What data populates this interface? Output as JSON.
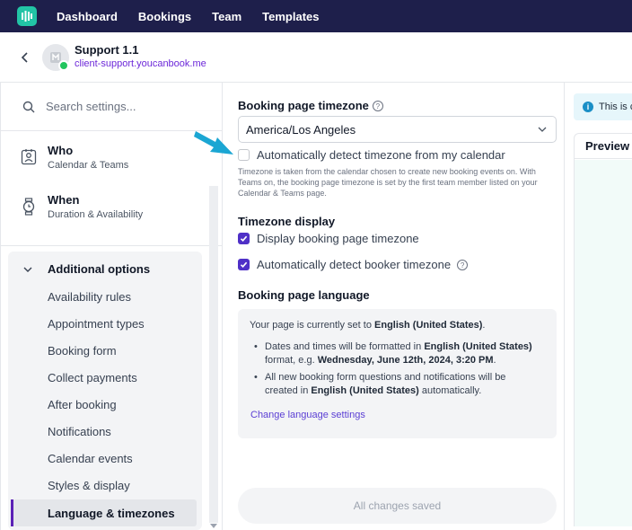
{
  "topnav": {
    "links": [
      "Dashboard",
      "Bookings",
      "Team",
      "Templates"
    ]
  },
  "header": {
    "site_name": "Support 1.1",
    "site_url": "client-support.youcanbook.me"
  },
  "sidebar": {
    "search_placeholder": "Search settings...",
    "main_items": [
      {
        "title": "Who",
        "subtitle": "Calendar & Teams",
        "icon": "contact-card-icon"
      },
      {
        "title": "When",
        "subtitle": "Duration & Availability",
        "icon": "watch-icon"
      }
    ],
    "additional": {
      "title": "Additional options",
      "items": [
        "Availability rules",
        "Appointment types",
        "Booking form",
        "Collect payments",
        "After booking",
        "Notifications",
        "Calendar events",
        "Styles & display",
        "Language & timezones"
      ],
      "active": "Language & timezones"
    }
  },
  "content": {
    "timezone_label": "Booking page timezone",
    "timezone_value": "America/Los Angeles",
    "auto_detect_calendar": {
      "label": "Automatically detect timezone from my calendar",
      "checked": false
    },
    "timezone_note": "Timezone is taken from the calendar chosen to create new booking events on. With Teams on, the booking page timezone is set by the first team member listed on your Calendar & Teams page.",
    "timezone_display_label": "Timezone display",
    "display_timezone": {
      "label": "Display booking page timezone",
      "checked": true
    },
    "detect_booker": {
      "label": "Automatically detect booker timezone",
      "checked": true
    },
    "language_label": "Booking page language",
    "language": {
      "intro_prefix": "Your page is currently set to ",
      "intro_lang": "English (United States)",
      "intro_suffix": ".",
      "bullet1_a": "Dates and times will be formatted in ",
      "bullet1_lang": "English (United States)",
      "bullet1_b": " format, e.g. ",
      "bullet1_example": "Wednesday, June 12th, 2024, 3:20 PM",
      "bullet1_c": ".",
      "bullet2_a": "All new booking form questions and notifications will be created in ",
      "bullet2_lang": "English (United States)",
      "bullet2_b": " automatically.",
      "link": "Change language settings"
    },
    "save_status": "All changes saved"
  },
  "preview": {
    "banner": "This is c",
    "tab": "Preview"
  },
  "colors": {
    "nav_bg": "#1e1f4b",
    "accent": "#4f30c7",
    "logo": "#22c4a6",
    "arrow": "#1ba6d3"
  }
}
